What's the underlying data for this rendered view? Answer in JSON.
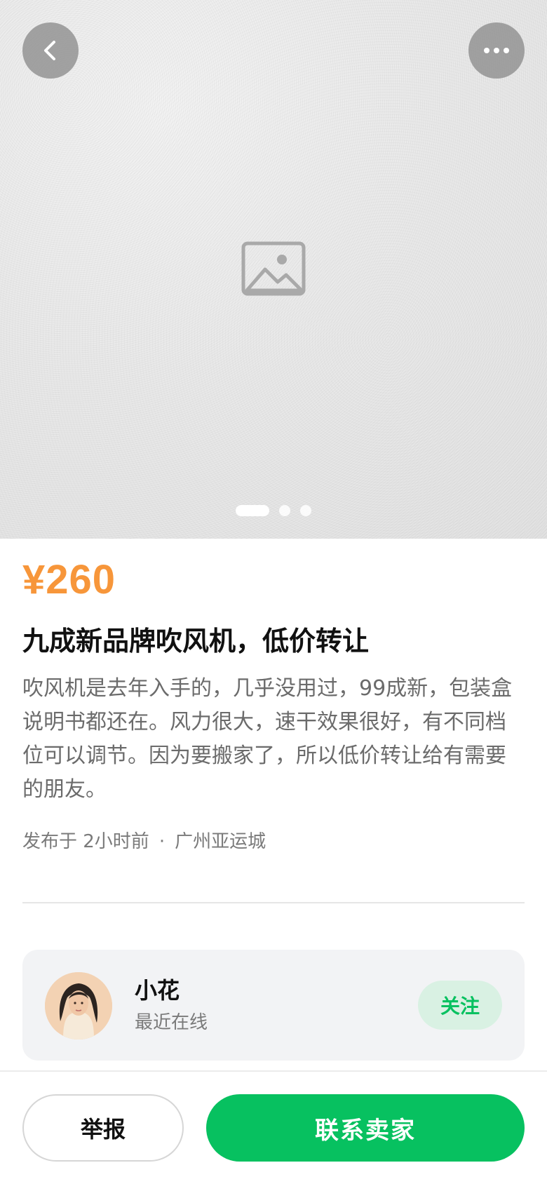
{
  "hero": {
    "icons": {
      "back": "chevron-left-icon",
      "more": "more-horizontal-icon",
      "placeholder": "image-placeholder-icon"
    },
    "carousel": {
      "total": 3,
      "active_index": 0
    }
  },
  "listing": {
    "price": "¥260",
    "title": "九成新品牌吹风机，低价转让",
    "description": "吹风机是去年入手的，几乎没用过，99成新，包装盒说明书都还在。风力很大，速干效果很好，有不同档位可以调节。因为要搬家了，所以低价转让给有需要的朋友。",
    "posted_time": "发布于 2小时前",
    "separator": "·",
    "location": "广州亚运城"
  },
  "seller": {
    "name": "小花",
    "status": "最近在线",
    "follow_label": "关注",
    "avatar_icon": "avatar"
  },
  "actions": {
    "report_label": "举报",
    "contact_label": "联系卖家"
  },
  "colors": {
    "price": "#f7963a",
    "brand_green": "#07c160",
    "follow_bg": "#d9f1e3",
    "card_bg": "#f2f3f5"
  }
}
